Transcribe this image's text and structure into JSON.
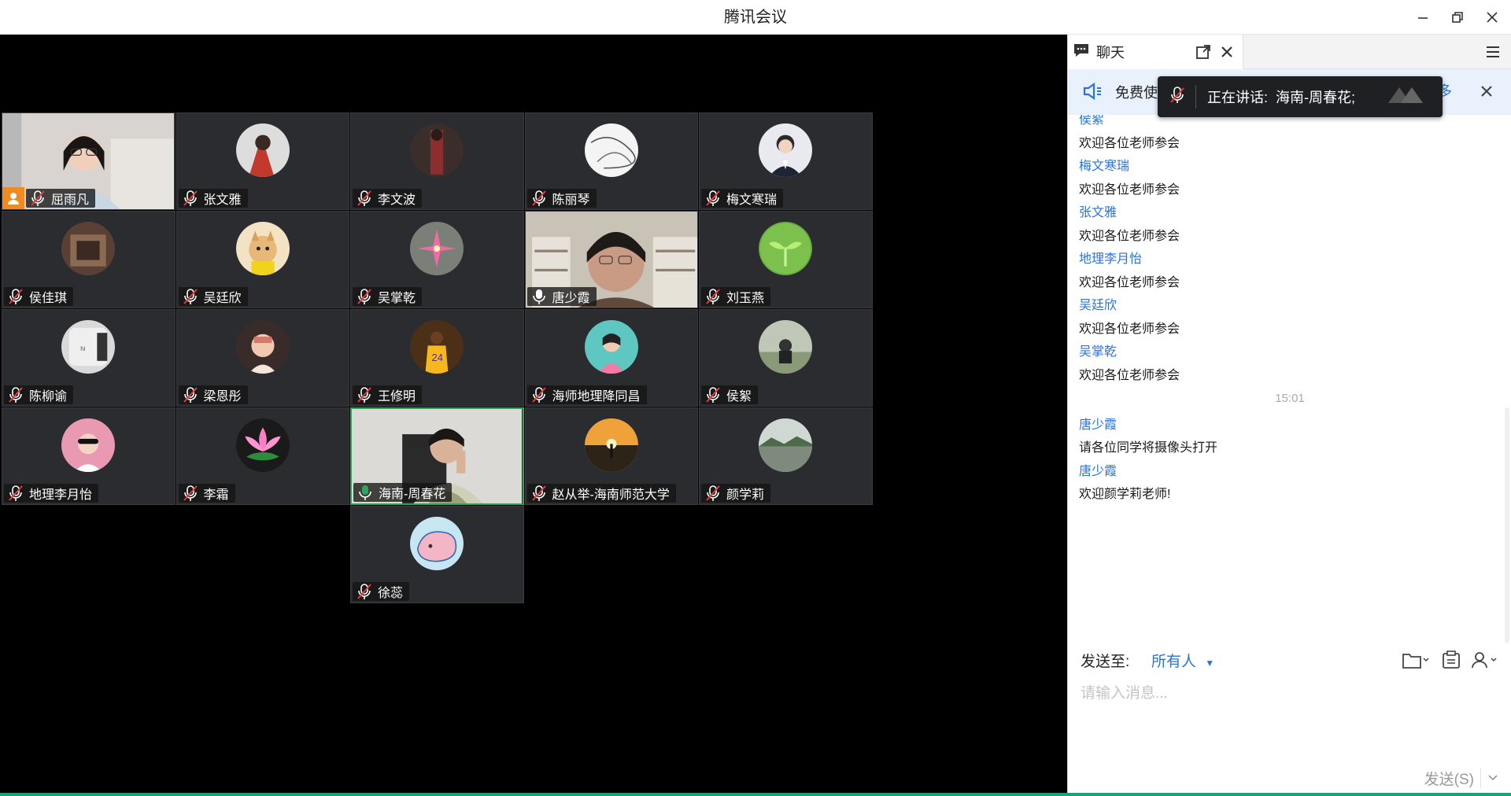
{
  "window": {
    "title": "腾讯会议"
  },
  "participants": [
    {
      "name": "屈雨凡",
      "mic": "muted",
      "video": true,
      "host": true
    },
    {
      "name": "张文雅",
      "mic": "muted"
    },
    {
      "name": "李文波",
      "mic": "muted"
    },
    {
      "name": "陈丽琴",
      "mic": "muted"
    },
    {
      "name": "梅文寒瑞",
      "mic": "muted"
    },
    {
      "name": "侯佳琪",
      "mic": "muted"
    },
    {
      "name": "吴廷欣",
      "mic": "muted"
    },
    {
      "name": "吴掌乾",
      "mic": "muted"
    },
    {
      "name": "唐少霞",
      "mic": "on",
      "video": true
    },
    {
      "name": "刘玉燕",
      "mic": "muted"
    },
    {
      "name": "陈柳谕",
      "mic": "muted"
    },
    {
      "name": "梁恩彤",
      "mic": "muted"
    },
    {
      "name": "王修明",
      "mic": "muted"
    },
    {
      "name": "海师地理降同昌",
      "mic": "muted"
    },
    {
      "name": "侯絮",
      "mic": "muted"
    },
    {
      "name": "地理李月怡",
      "mic": "muted"
    },
    {
      "name": "李霜",
      "mic": "muted"
    },
    {
      "name": "海南-周春花",
      "mic": "speaking",
      "video": true
    },
    {
      "name": "赵从举-海南师范大学",
      "mic": "muted"
    },
    {
      "name": "颜学莉",
      "mic": "muted"
    },
    {
      "name": "徐蕊",
      "mic": "muted"
    }
  ],
  "chat": {
    "tab_label": "聊天",
    "banner_text": "免费使",
    "banner_more": "多",
    "speaking_label": "正在讲话:",
    "speaking_name": "海南-周春花;",
    "messages": [
      {
        "sender": "侯絮",
        "text": "欢迎各位老师参会"
      },
      {
        "sender": "梅文寒瑞",
        "text": "欢迎各位老师参会"
      },
      {
        "sender": "张文雅",
        "text": "欢迎各位老师参会"
      },
      {
        "sender": "地理李月怡",
        "text": "欢迎各位老师参会"
      },
      {
        "sender": "吴廷欣",
        "text": "欢迎各位老师参会"
      },
      {
        "sender": "吴掌乾",
        "text": "欢迎各位老师参会"
      }
    ],
    "time_divider": "15:01",
    "messages_after": [
      {
        "sender": "唐少霞",
        "text": "请各位同学将摄像头打开"
      },
      {
        "sender": "唐少霞",
        "text": "欢迎颜学莉老师!"
      }
    ],
    "send_to_label": "发送至:",
    "recipient": "所有人",
    "input_placeholder": "请输入消息...",
    "send_button": "发送(S)"
  },
  "colors": {
    "accent": "#2b73d9",
    "speaking": "#2fa65a",
    "host": "#f08a24"
  }
}
